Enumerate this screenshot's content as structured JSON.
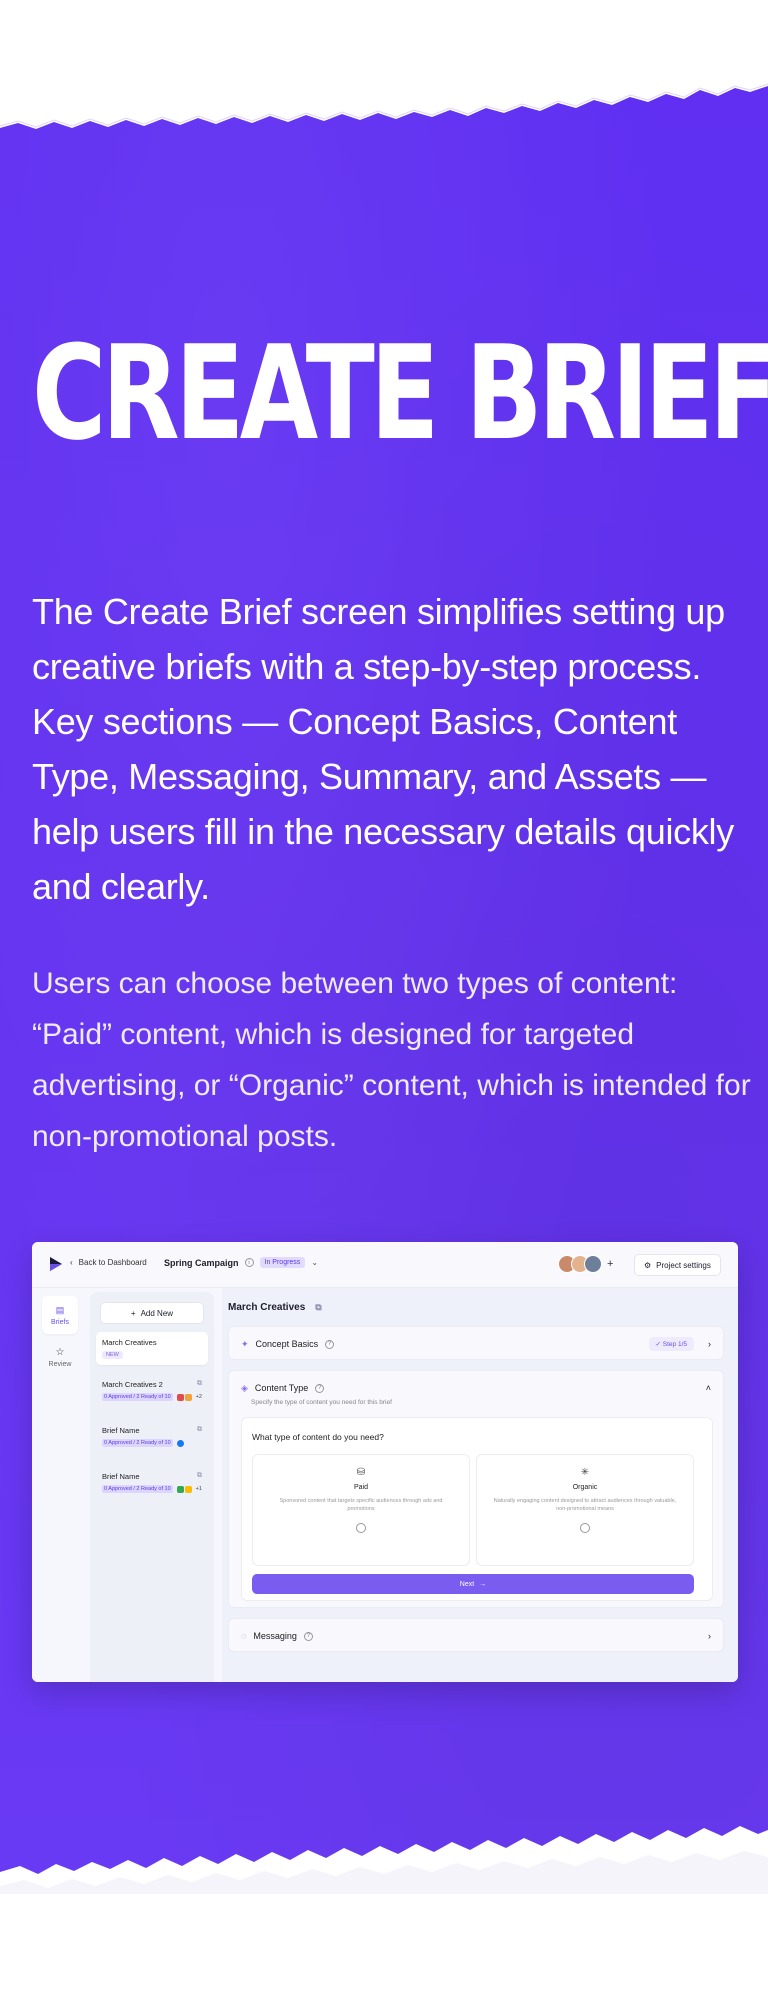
{
  "hero": {
    "title": "CREATE BRIEF",
    "lead": "The Create Brief screen simplifies setting up creative briefs with a step-by-step process. Key sections — Concept Basics, Content Type, Messaging, Summary, and Assets — help users fill in the necessary details quickly and clearly.",
    "sub": "Users can choose between two types of content: “Paid” content, which is designed for targeted advertising, or “Organic” content, which is intended for non-promotional posts."
  },
  "colors": {
    "brand_purple": "#6432f0",
    "accent": "#7b5cf0"
  },
  "app": {
    "topbar": {
      "back_label": "Back to Dashboard",
      "campaign_name": "Spring Campaign",
      "status_badge": "In Progress",
      "add_member": "+",
      "project_settings": "Project settings"
    },
    "rail": {
      "briefs": "Briefs",
      "review": "Review"
    },
    "briefs_panel": {
      "add_new": "Add New",
      "items": [
        {
          "title": "March Creatives",
          "tag": "NEW"
        },
        {
          "title": "March Creatives 2",
          "progress": "0 Approved / 2 Ready of 10",
          "extra": "+2"
        },
        {
          "title": "Brief Name",
          "progress": "0 Approved / 2 Ready of 10"
        },
        {
          "title": "Brief Name",
          "progress": "0 Approved / 2 Ready of 10",
          "extra": "+1"
        }
      ]
    },
    "main": {
      "title": "March Creatives",
      "concept_basics": {
        "label": "Concept Basics",
        "step": "Step 1/5"
      },
      "content_type": {
        "label": "Content Type",
        "subtitle": "Specify the type of content you need for this brief",
        "question": "What type of content do you need?",
        "options": [
          {
            "title": "Paid",
            "desc": "Sponsored content that targets specific audiences through ads and promotions"
          },
          {
            "title": "Organic",
            "desc": "Naturally engaging content designed to attract audiences through valuable, non-promotional means"
          }
        ],
        "next_label": "Next"
      },
      "messaging": {
        "label": "Messaging"
      }
    }
  }
}
